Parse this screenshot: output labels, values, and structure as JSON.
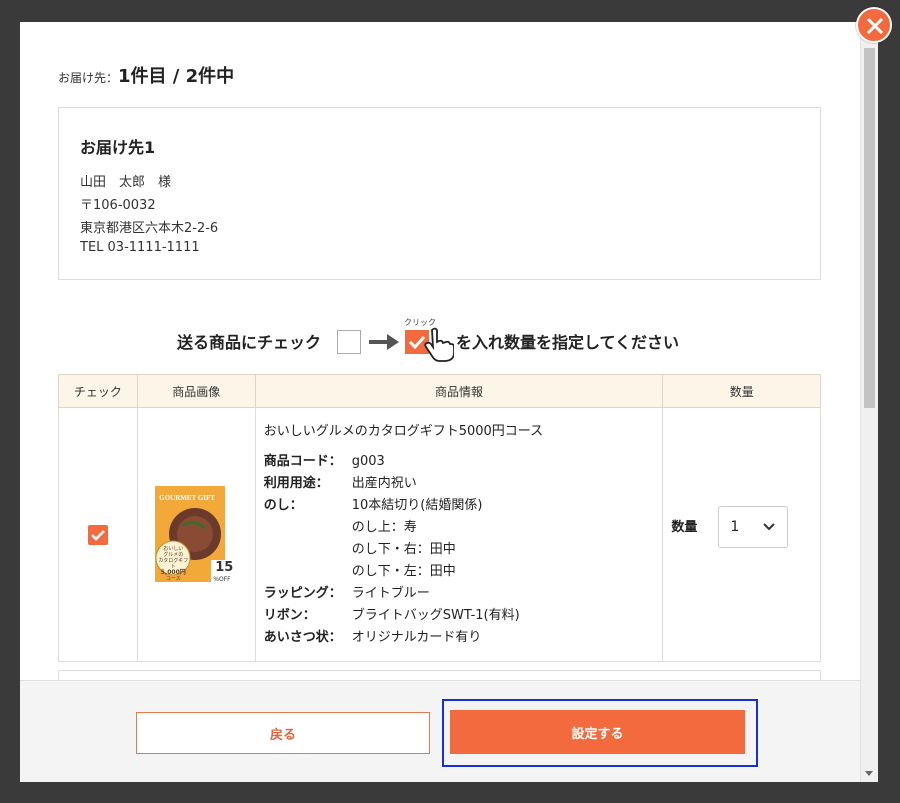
{
  "header": {
    "prefix": "お届け先：",
    "current": "1件目 / 2件中"
  },
  "address": {
    "title": "お届け先1",
    "name": "山田　太郎　様",
    "postal": "〒106-0032",
    "street": "東京都港区六本木2-2-6",
    "tel": "TEL 03-1111-1111"
  },
  "instruction": {
    "part1": "送る商品にチェック",
    "click_label": "クリック",
    "part2": "を入れ数量を指定してください"
  },
  "table": {
    "headers": [
      "チェック",
      "商品画像",
      "商品情報",
      "数量"
    ]
  },
  "product": {
    "checked": true,
    "image_text": {
      "brand": "GOURMET GIFT",
      "badge1": "おいしい",
      "badge2": "グルメの",
      "badge3": "カタログギフト",
      "badge4": "5,000円",
      "badge5": "コース",
      "discount": "15",
      "discount_unit": "%OFF"
    },
    "name": "おいしいグルメのカタログギフト5000円コース",
    "props": [
      {
        "label": "商品コード：",
        "value": "g003"
      },
      {
        "label": "利用用途：",
        "value": "出産内祝い"
      },
      {
        "label": "のし：",
        "values": [
          "10本結切り(結婚関係)",
          "のし上：寿",
          "のし下・右：田中",
          "のし下・左：田中"
        ]
      },
      {
        "label": "ラッピング：",
        "value": "ライトブルー"
      },
      {
        "label": "リボン：",
        "value": "ブライトバッグSWT-1(有料)"
      },
      {
        "label": "あいさつ状：",
        "value": "オリジナルカード有り"
      }
    ],
    "qty_label": "数量",
    "qty_value": "1"
  },
  "footer": {
    "back_label": "戻る",
    "submit_label": "設定する"
  },
  "colors": {
    "accent": "#f26a3d",
    "focus_outline": "#1a2ed8",
    "header_bg": "#fdf6e8"
  }
}
